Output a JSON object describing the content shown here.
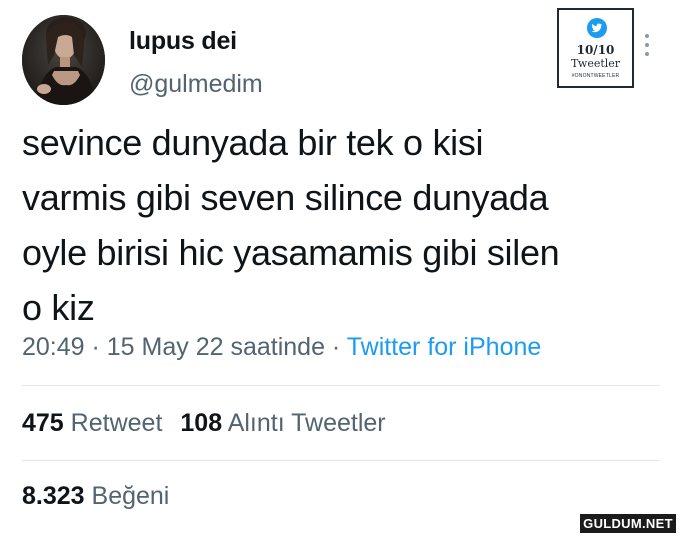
{
  "author": {
    "display_name": "lupus dei",
    "handle": "@gulmedim"
  },
  "badge": {
    "score": "10/10",
    "word": "Tweetler",
    "tag": "#ONONTWEETLER"
  },
  "tweet": {
    "text": "sevince dunyada bir tek o kisi\nvarmis gibi seven silince dunyada\noyle birisi hic yasamamis gibi silen\no kiz",
    "time": "20:49",
    "separator_1": " · ",
    "date": "15 May 22 saatinde",
    "separator_2": " · ",
    "source": "Twitter for iPhone"
  },
  "stats": {
    "retweet_count": "475",
    "retweet_label": "Retweet",
    "quote_count": "108",
    "quote_label": "Alıntı Tweetler",
    "like_count": "8.323",
    "like_label": "Beğeni"
  },
  "watermark": {
    "text": "GULDUM.NET"
  },
  "colors": {
    "accent": "#1d9bf0",
    "secondary_text": "#536471",
    "primary_text": "#0f1419",
    "divider": "#e1e8ed"
  }
}
